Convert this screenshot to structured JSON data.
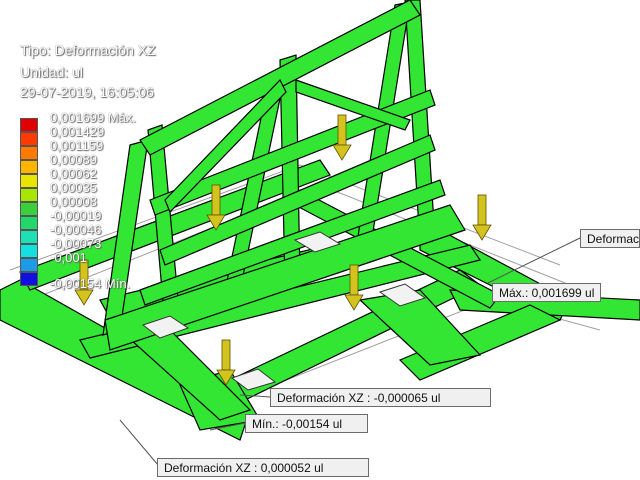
{
  "header": {
    "tipo": "Tipo: Deformación XZ",
    "unidad": "Unidad: ul",
    "fecha": "29-07-2019, 16:05:06"
  },
  "legend": {
    "entries": [
      {
        "label": "0,001699 Máx.",
        "color": "#e00000"
      },
      {
        "label": "0,001429",
        "color": "#ff3a00"
      },
      {
        "label": "0,001159",
        "color": "#ff7a00"
      },
      {
        "label": "0,00089",
        "color": "#ffb400"
      },
      {
        "label": "0,00062",
        "color": "#e6e600"
      },
      {
        "label": "0,00035",
        "color": "#a6e600"
      },
      {
        "label": "0,00008",
        "color": "#3ccf3c"
      },
      {
        "label": "-0,00019",
        "color": "#22d86a"
      },
      {
        "label": "-0,00046",
        "color": "#1ee0b4"
      },
      {
        "label": "-0,00073",
        "color": "#14e0e0"
      },
      {
        "label": "-0,001",
        "color": "#1e9be6"
      },
      {
        "label": "-0,00154 Mín.",
        "color": "#1010e0"
      }
    ]
  },
  "probes": {
    "max": "Máx.: 0,001699 ul",
    "right_cut": "Deformac",
    "mid": "Deformación XZ : -0,000065 ul",
    "min": "Mín.: -0,00154 ul",
    "bottom": "Deformación XZ : 0,000052 ul"
  },
  "colors": {
    "mesh": "#33e633",
    "edge": "#000000",
    "load": "#d4c21e"
  }
}
